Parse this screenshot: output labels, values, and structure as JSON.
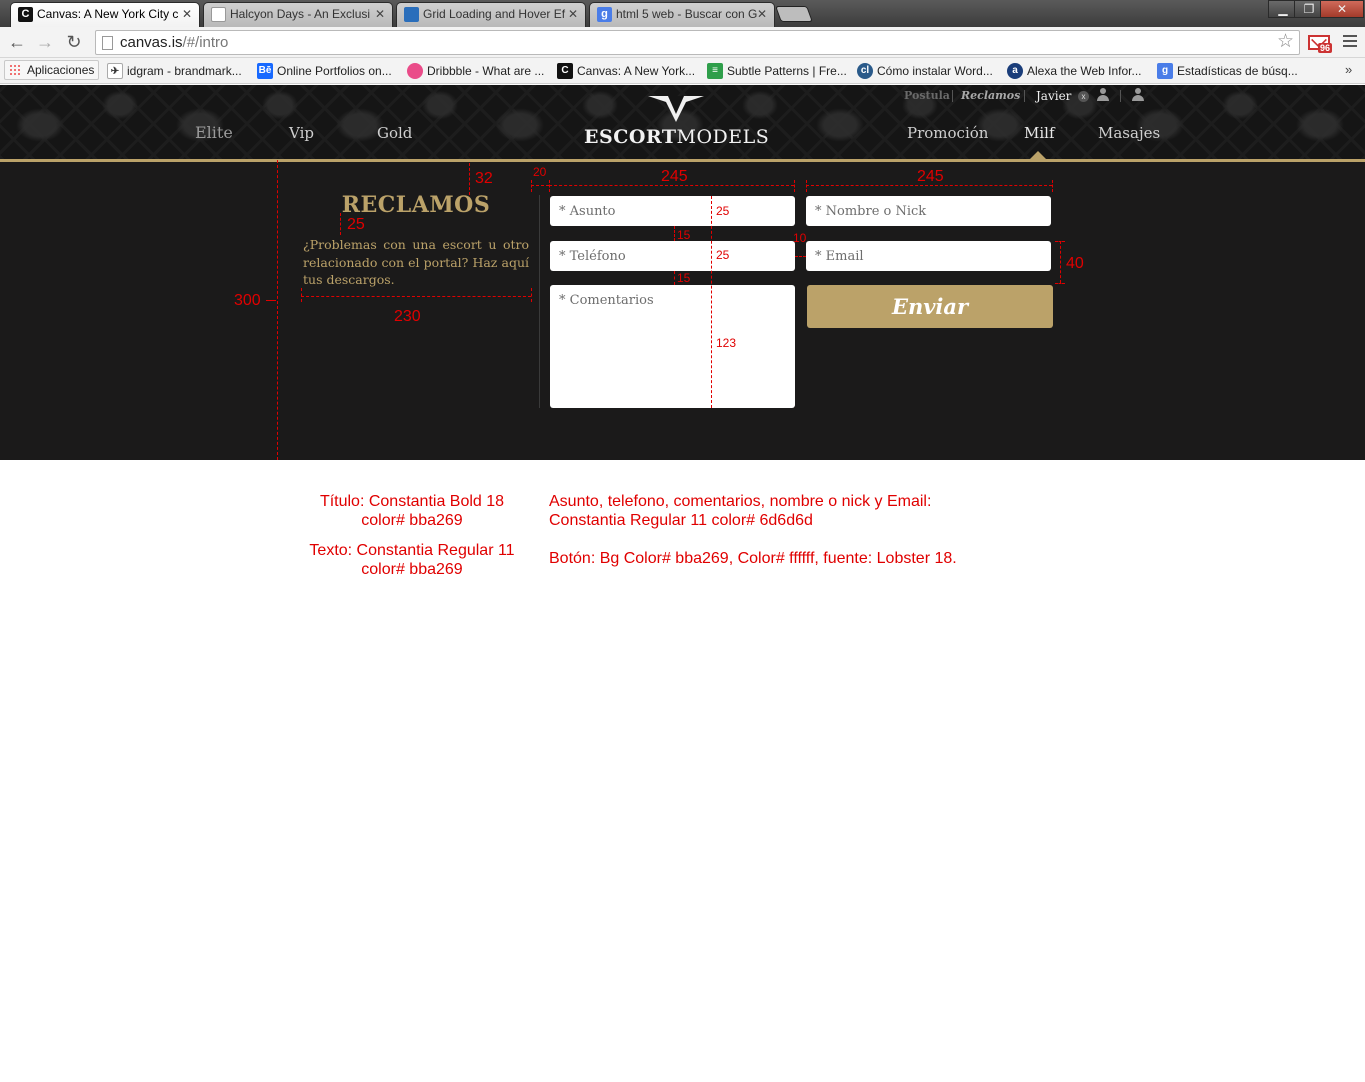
{
  "browser": {
    "tabs": [
      {
        "title": "Canvas: A New York City c",
        "favicon": "C",
        "active": true
      },
      {
        "title": "Halcyon Days - An Exclusi",
        "favicon": "",
        "active": false
      },
      {
        "title": "Grid Loading and Hover Ef",
        "favicon": "",
        "active": false
      },
      {
        "title": "html 5 web - Buscar con G",
        "favicon": "g",
        "active": false
      }
    ],
    "url_host": "canvas.is",
    "url_path": "/#/intro",
    "gmail_count": "96",
    "bookmarks": [
      "Aplicaciones",
      "idgram - brandmark...",
      "Online Portfolios on...",
      "Dribbble - What are ...",
      "Canvas: A New York...",
      "Subtle Patterns | Fre...",
      "Cómo instalar Word...",
      "Alexa the Web Infor...",
      "Estadísticas de búsq..."
    ],
    "bookmarks_more": "»"
  },
  "site": {
    "nav_left": [
      "Elite",
      "Vip",
      "Gold"
    ],
    "nav_right": [
      "Promoción",
      "Milf",
      "Masajes"
    ],
    "logo_bold": "ESCORT",
    "logo_regular": "MODELS",
    "top_links": {
      "postula": "Postula",
      "reclamos": "Reclamos",
      "user": "Javier",
      "close": "x"
    }
  },
  "form": {
    "title": "RECLAMOS",
    "text": "¿Problemas con una escort u otro relacionado con el portal? Haz aquí tus descargos.",
    "asunto_placeholder": "* Asunto",
    "telefono_placeholder": "* Teléfono",
    "comentarios_placeholder": "* Comentarios",
    "nombre_placeholder": "* Nombre o Nick",
    "email_placeholder": "* Email",
    "submit_label": "Enviar"
  },
  "annotations": {
    "d32": "32",
    "d20": "20",
    "d245a": "245",
    "d245b": "245",
    "d25title": "25",
    "d25a": "25",
    "d25b": "25",
    "d15a": "15",
    "d15b": "15",
    "d10": "10",
    "d40": "40",
    "d300": "300",
    "d230": "230",
    "d123": "123"
  },
  "notes": {
    "title_spec_1": "Título: Constantia Bold 18",
    "title_spec_2": "color# bba269",
    "text_spec_1": "Texto: Constantia Regular 11",
    "text_spec_2": "color# bba269",
    "fields_spec_1": "Asunto, telefono, comentarios, nombre o nick y Email:",
    "fields_spec_2": "Constantia Regular 11 color# 6d6d6d",
    "button_spec": "Botón: Bg Color# bba269, Color# ffffff, fuente: Lobster 18."
  },
  "colors": {
    "gold": "#bba269",
    "field_text": "#6d6d6d",
    "annotation": "#e00000"
  }
}
